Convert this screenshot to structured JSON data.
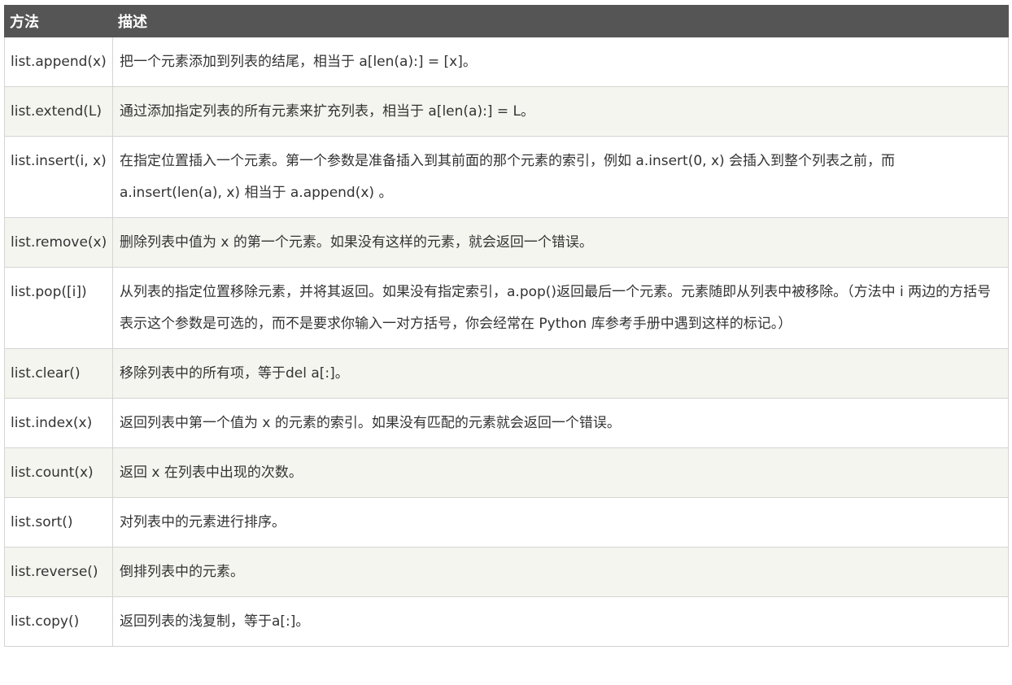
{
  "table": {
    "headers": [
      "方法",
      "描述"
    ],
    "rows": [
      {
        "method": "list.append(x)",
        "description": "把一个元素添加到列表的结尾，相当于 a[len(a):] = [x]。"
      },
      {
        "method": "list.extend(L)",
        "description": "通过添加指定列表的所有元素来扩充列表，相当于 a[len(a):] = L。"
      },
      {
        "method": "list.insert(i, x)",
        "description": "在指定位置插入一个元素。第一个参数是准备插入到其前面的那个元素的索引，例如 a.insert(0, x) 会插入到整个列表之前，而 a.insert(len(a), x) 相当于 a.append(x) 。"
      },
      {
        "method": "list.remove(x)",
        "description": "删除列表中值为 x 的第一个元素。如果没有这样的元素，就会返回一个错误。"
      },
      {
        "method": "list.pop([i])",
        "description": "从列表的指定位置移除元素，并将其返回。如果没有指定索引，a.pop()返回最后一个元素。元素随即从列表中被移除。（方法中 i 两边的方括号表示这个参数是可选的，而不是要求你输入一对方括号，你会经常在 Python 库参考手册中遇到这样的标记。）"
      },
      {
        "method": "list.clear()",
        "description": "移除列表中的所有项，等于del a[:]。"
      },
      {
        "method": "list.index(x)",
        "description": "返回列表中第一个值为 x 的元素的索引。如果没有匹配的元素就会返回一个错误。"
      },
      {
        "method": "list.count(x)",
        "description": "返回 x 在列表中出现的次数。"
      },
      {
        "method": "list.sort()",
        "description": "对列表中的元素进行排序。"
      },
      {
        "method": "list.reverse()",
        "description": "倒排列表中的元素。"
      },
      {
        "method": "list.copy()",
        "description": "返回列表的浅复制，等于a[:]。"
      }
    ]
  }
}
